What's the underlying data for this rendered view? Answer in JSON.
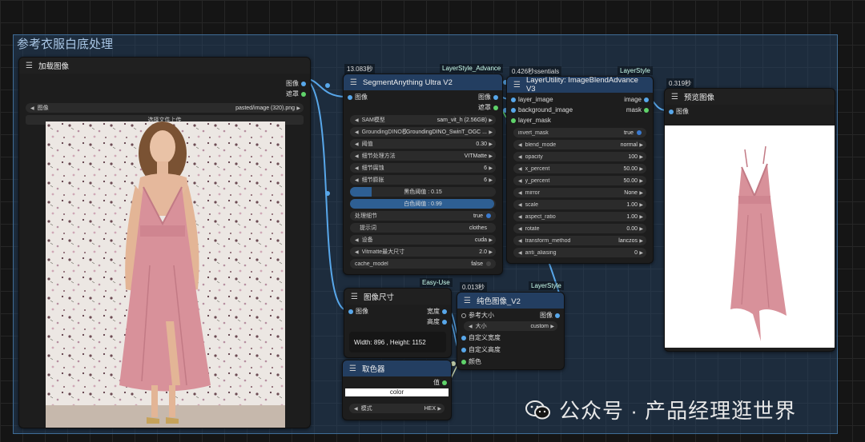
{
  "group": {
    "title": "参考衣服白底处理"
  },
  "load_image": {
    "title": "加载图像",
    "outputs": [
      "图像",
      "遮罩"
    ],
    "image_label": "图像",
    "image_value": "pasted/image (320).png",
    "upload_label": "选择文件上传"
  },
  "segment": {
    "time": "13.083秒",
    "tag": "LayerStyle_Advance",
    "title": "SegmentAnything Ultra V2",
    "input": "图像",
    "outputs": [
      "图像",
      "遮罩"
    ],
    "widgets": [
      {
        "label": "SAM模型",
        "value": "sam_vit_h (2.56GB)"
      },
      {
        "label": "GroundingDINO模型",
        "value": "GroundingDINO_SwinT_OGC ..."
      },
      {
        "label": "阈值",
        "value": "0.30"
      },
      {
        "label": "细节处理方法",
        "value": "VITMatte"
      },
      {
        "label": "细节腐蚀",
        "value": "6"
      },
      {
        "label": "细节膨胀",
        "value": "6"
      }
    ],
    "black_slider": "黑色阈值 : 0.15",
    "white_slider": "白色阈值 : 0.99",
    "process_detail_label": "处理细节",
    "process_detail_value": "true",
    "prompt_label": "提示词",
    "prompt_value": "clothes",
    "device_label": "设备",
    "device_value": "cuda",
    "vitmatte_label": "Vitmatte最大尺寸",
    "vitmatte_value": "2.0",
    "cache_label": "cache_model",
    "cache_value": "false"
  },
  "blend": {
    "time": "0.426秒",
    "tag_left": "ssentials",
    "tag": "LayerStyle",
    "title": "LayerUtility: ImageBlendAdvance V3",
    "inputs": [
      "layer_image",
      "background_image",
      "layer_mask"
    ],
    "outputs": [
      "image",
      "mask"
    ],
    "invert_label": "invert_mask",
    "invert_value": "true",
    "widgets": [
      {
        "label": "blend_mode",
        "value": "normal"
      },
      {
        "label": "opacity",
        "value": "100"
      },
      {
        "label": "x_percent",
        "value": "50.00"
      },
      {
        "label": "y_percent",
        "value": "50.00"
      },
      {
        "label": "mirror",
        "value": "None"
      },
      {
        "label": "scale",
        "value": "1.00"
      },
      {
        "label": "aspect_ratio",
        "value": "1.00"
      },
      {
        "label": "rotate",
        "value": "0.00"
      },
      {
        "label": "transform_method",
        "value": "lanczos"
      },
      {
        "label": "anti_aliasing",
        "value": "0"
      }
    ]
  },
  "preview": {
    "time": "0.319秒",
    "title": "预览图像",
    "input": "图像"
  },
  "image_size": {
    "tag": "Easy-Use",
    "title": "图像尺寸",
    "input": "图像",
    "outputs": [
      "宽度",
      "高度"
    ],
    "info": "Width: 896 , Height: 1152"
  },
  "color_picker": {
    "title": "取色器",
    "output": "值",
    "color_label": "color",
    "mode_label": "模式",
    "mode_value": "HEX"
  },
  "solid_image": {
    "time": "0.013秒",
    "tag": "LayerStyle",
    "title": "纯色图像_V2",
    "inputs": [
      "参考大小",
      "自定义宽度",
      "自定义高度",
      "颜色"
    ],
    "output": "图像",
    "size_label": "大小",
    "size_value": "custom"
  },
  "watermark": {
    "text": "公众号 · 产品经理逛世界",
    "icon": "wechat-icon"
  },
  "colors": {
    "group_bg": "#284a6e",
    "node_header_blue": "#233e61",
    "wire_blue": "#58a7ea",
    "dress_pink": "#d8919a"
  }
}
